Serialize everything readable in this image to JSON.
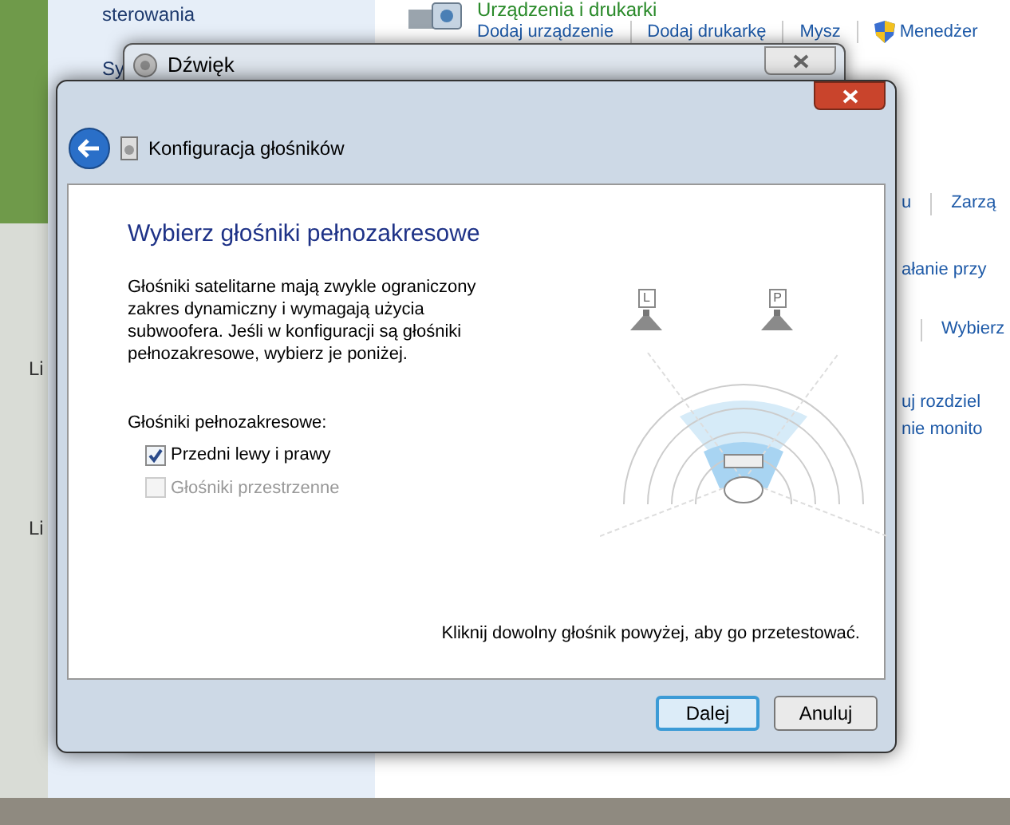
{
  "background_window": {
    "sidebar_items": [
      "sterowania",
      "Sy"
    ],
    "heading": "Urządzenia i drukarki",
    "links": [
      "Dodaj urządzenie",
      "Dodaj drukarkę",
      "Mysz",
      "Menedżer"
    ],
    "right_edge": [
      {
        "texts": [
          "u",
          "Zarzą"
        ]
      },
      {
        "texts": [
          "ałanie przy"
        ]
      },
      {
        "texts": [
          "Wybierz"
        ],
        "leading_divider": true
      },
      {
        "texts": [
          "uj rozdziel"
        ]
      },
      {
        "texts": [
          "nie monito"
        ]
      }
    ]
  },
  "desktop_texts": [
    "Li",
    "Li"
  ],
  "sound_dialog": {
    "title": "Dźwięk"
  },
  "wizard": {
    "title": "Konfiguracja głośników",
    "heading": "Wybierz głośniki pełnozakresowe",
    "description": "Głośniki satelitarne mają zwykle ograniczony zakres dynamiczny i wymagają użycia subwoofera. Jeśli w konfiguracji są głośniki pełnozakresowe, wybierz je poniżej.",
    "group_label": "Głośniki pełnozakresowe:",
    "options": [
      {
        "label": "Przedni lewy i prawy",
        "checked": true,
        "disabled": false
      },
      {
        "label": "Głośniki przestrzenne",
        "checked": false,
        "disabled": true
      }
    ],
    "speakers": [
      {
        "label": "L"
      },
      {
        "label": "P"
      }
    ],
    "hint": "Kliknij dowolny głośnik powyżej, aby go przetestować.",
    "buttons": [
      {
        "label": "Dalej",
        "default": true
      },
      {
        "label": "Anuluj",
        "default": false
      }
    ]
  }
}
